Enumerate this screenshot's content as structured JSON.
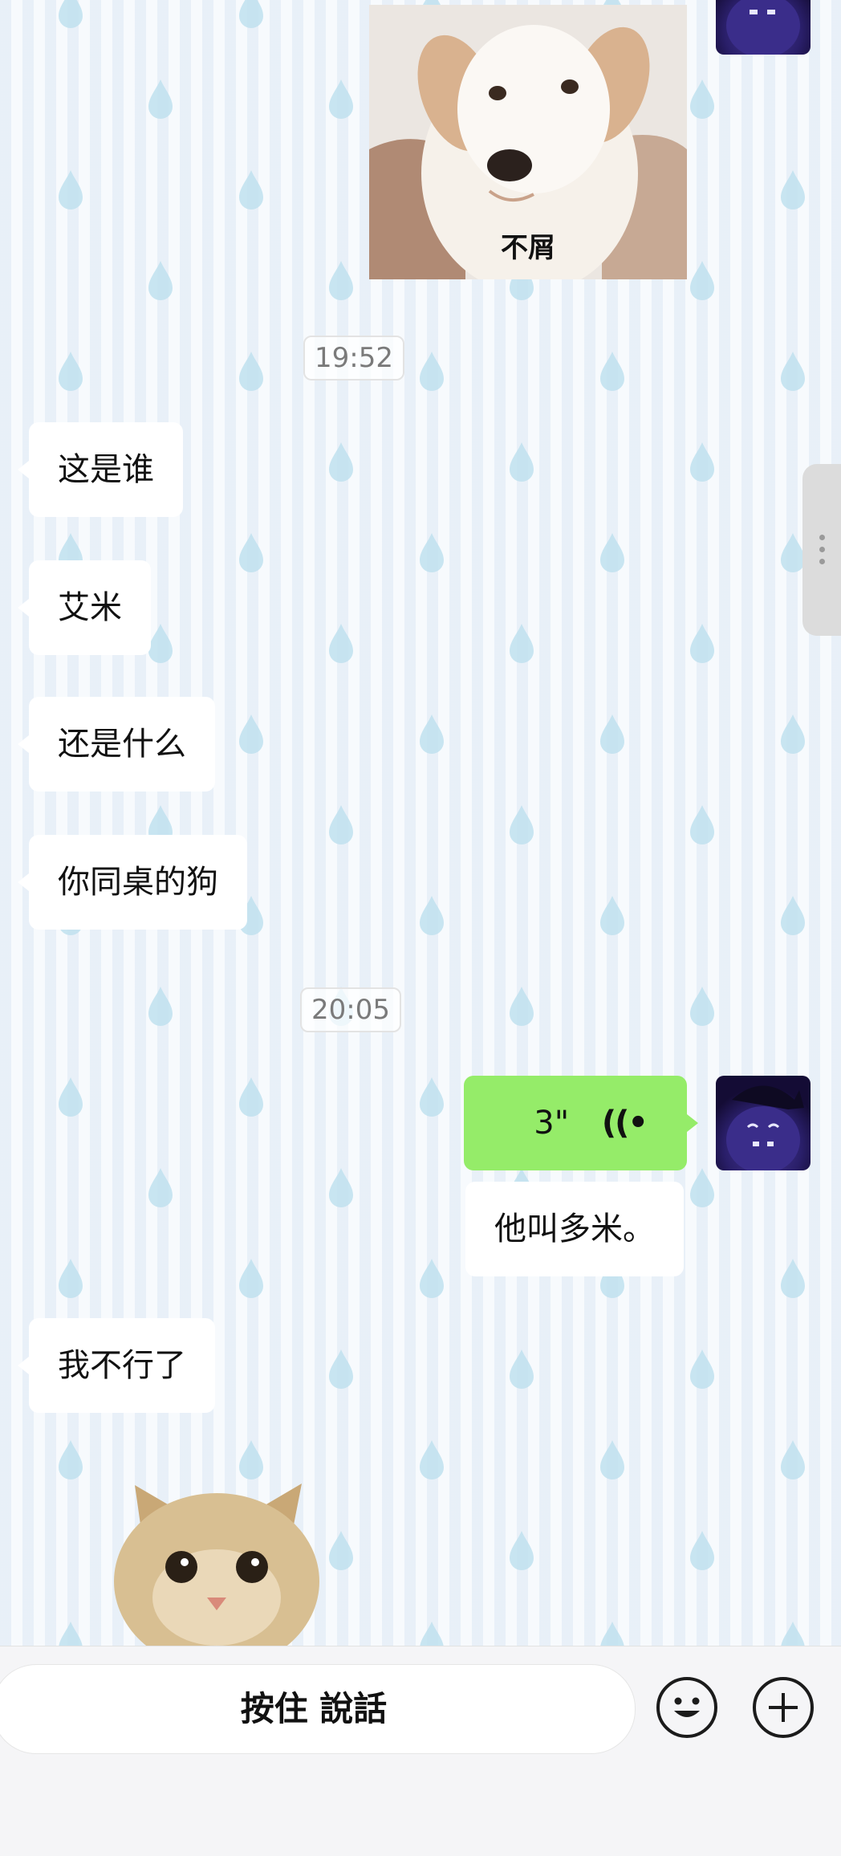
{
  "messages": {
    "dog_caption": "不屑",
    "time_1": "19:52",
    "msg_1": "这是谁",
    "msg_2": "艾米",
    "msg_3": "还是什么",
    "msg_4": "你同桌的狗",
    "time_2": "20:05",
    "voice_duration": "3\"",
    "msg_5": "他叫多米。",
    "msg_6": "我不行了"
  },
  "input_bar": {
    "hold_to_talk_label": "按住 說話"
  },
  "icons": {
    "emoji": "smiley-face-icon",
    "more": "plus-icon",
    "voice": "voice-wave-icon",
    "side_menu": "vertical-dots-icon"
  },
  "colors": {
    "voice_bubble": "#95ec69",
    "incoming_bubble": "#ffffff",
    "raindrop": "#bfe0ef"
  }
}
